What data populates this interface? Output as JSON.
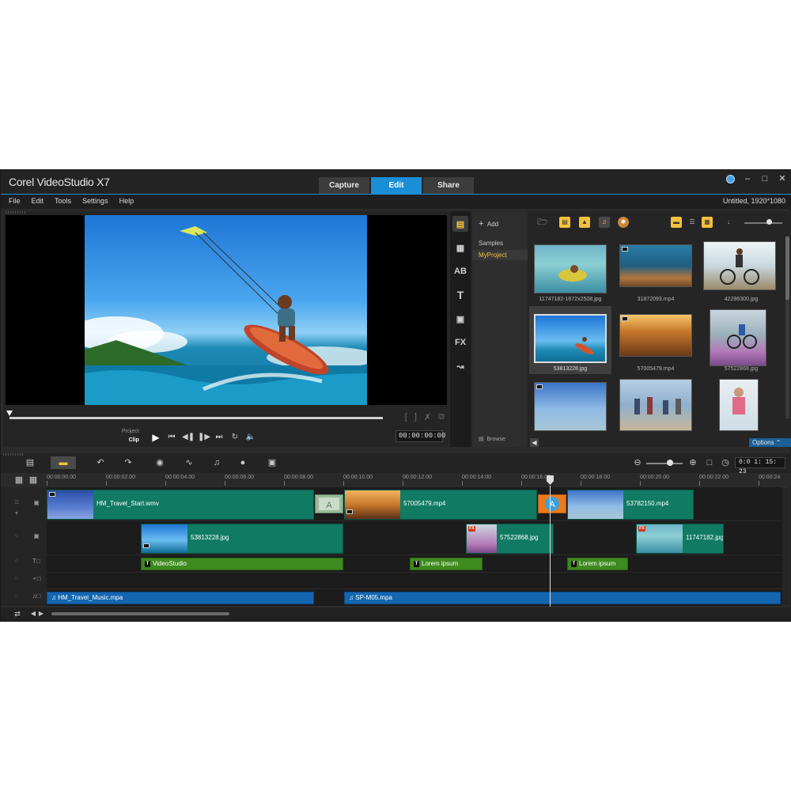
{
  "app": {
    "title": "Corel VideoStudio X7",
    "project_info": "Untitled, 1920*1080"
  },
  "main_tabs": [
    {
      "label": "Capture"
    },
    {
      "label": "Edit",
      "active": true
    },
    {
      "label": "Share"
    }
  ],
  "menu": [
    "File",
    "Edit",
    "Tools",
    "Settings",
    "Help"
  ],
  "preview": {
    "mode_project": "Project",
    "mode_clip": "Clip",
    "timecode": "00:00:00:00"
  },
  "library": {
    "add_label": "Add",
    "folders": [
      {
        "label": "Samples"
      },
      {
        "label": "MyProject",
        "active": true
      }
    ],
    "browse_label": "Browse",
    "options_label": "Options",
    "thumbnails": [
      {
        "label": "11747182-1672x2508.jpg"
      },
      {
        "label": "31872093.mp4"
      },
      {
        "label": "42296300.jpg"
      },
      {
        "label": "53813228.jpg"
      },
      {
        "label": "57005479.mp4"
      },
      {
        "label": "57522868.jpg"
      },
      {
        "label": ""
      },
      {
        "label": ""
      },
      {
        "label": ""
      }
    ]
  },
  "timeline": {
    "timecode": "0:0 1: 15: 23",
    "ruler": [
      "00:00:00.00",
      "00:00:02.00",
      "00:00:04.00",
      "00:00:06.00",
      "00:00:08.00",
      "00:00:10.00",
      "00:00:12.00",
      "00:00:14.00",
      "00:00:16.00",
      "00:00:18.00",
      "00:00:20.00",
      "00:00:22.00",
      "00:00:24"
    ],
    "video_track": [
      "HM_Travel_Start.wmv",
      "57005479.mp4",
      "53782150.mp4"
    ],
    "overlay_track": [
      "53813228.jpg",
      "57522868.jpg",
      "11747182.jpg"
    ],
    "title_track": [
      "VideoStudio",
      "Lorem ipsum",
      "Lorem ipsum"
    ],
    "music_track": [
      "HM_Travel_Music.mpa",
      "SP-M05.mpa"
    ]
  },
  "colors": {
    "accent": "#1a8fd6",
    "video_clip": "#117a63",
    "title_clip": "#3d8a1e",
    "music_clip": "#1466b0",
    "library_highlight": "#f3c13a"
  },
  "icons": {
    "window": [
      "help-globe-icon",
      "minimize-icon",
      "maximize-icon",
      "close-icon"
    ],
    "transport": [
      "play-icon",
      "home-icon",
      "prev-frame-icon",
      "next-frame-icon",
      "end-icon",
      "repeat-icon",
      "volume-icon"
    ],
    "library_side": [
      "media-icon",
      "instant-project-icon",
      "transition-icon",
      "title-icon",
      "graphic-icon",
      "filter-fx-icon",
      "path-icon"
    ]
  }
}
